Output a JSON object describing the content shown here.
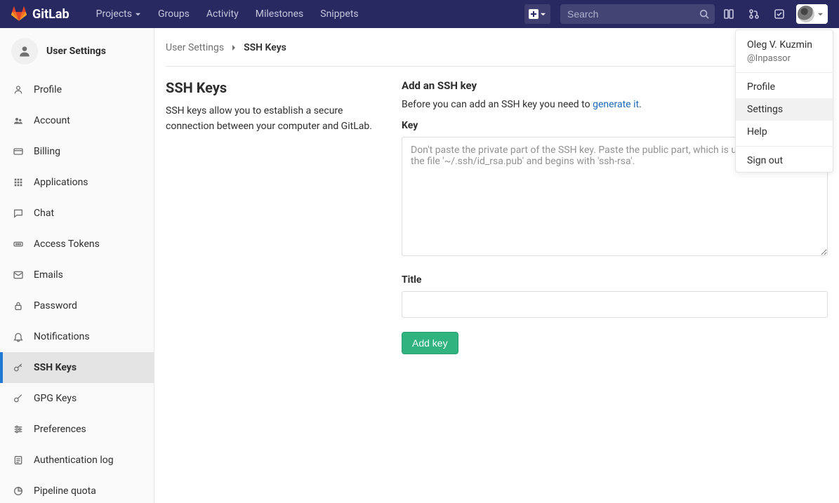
{
  "navbar": {
    "brand": "GitLab",
    "links": {
      "projects": "Projects",
      "groups": "Groups",
      "activity": "Activity",
      "milestones": "Milestones",
      "snippets": "Snippets"
    },
    "search_placeholder": "Search"
  },
  "user_menu": {
    "name": "Oleg V. Kuzmin",
    "handle": "@Inpassor",
    "items": {
      "profile": "Profile",
      "settings": "Settings",
      "help": "Help",
      "sign_out": "Sign out"
    }
  },
  "sidebar": {
    "context_title": "User Settings",
    "items": [
      {
        "label": "Profile",
        "icon": "profile-icon"
      },
      {
        "label": "Account",
        "icon": "account-icon"
      },
      {
        "label": "Billing",
        "icon": "billing-icon"
      },
      {
        "label": "Applications",
        "icon": "apps-icon"
      },
      {
        "label": "Chat",
        "icon": "chat-icon"
      },
      {
        "label": "Access Tokens",
        "icon": "tokens-icon"
      },
      {
        "label": "Emails",
        "icon": "emails-icon"
      },
      {
        "label": "Password",
        "icon": "password-icon"
      },
      {
        "label": "Notifications",
        "icon": "notifications-icon"
      },
      {
        "label": "SSH Keys",
        "icon": "ssh-icon",
        "active": true
      },
      {
        "label": "GPG Keys",
        "icon": "gpg-icon"
      },
      {
        "label": "Preferences",
        "icon": "prefs-icon"
      },
      {
        "label": "Authentication log",
        "icon": "authlog-icon"
      },
      {
        "label": "Pipeline quota",
        "icon": "quota-icon"
      }
    ]
  },
  "breadcrumb": {
    "root": "User Settings",
    "current": "SSH Keys"
  },
  "page": {
    "title": "SSH Keys",
    "description": "SSH keys allow you to establish a secure connection between your computer and GitLab.",
    "add_heading": "Add an SSH key",
    "before_text": "Before you can add an SSH key you need to ",
    "generate_link": "generate it",
    "after_text": ".",
    "key_label": "Key",
    "key_placeholder": "Don't paste the private part of the SSH key. Paste the public part, which is usually contained in the file '~/.ssh/id_rsa.pub' and begins with 'ssh-rsa'.",
    "title_label": "Title",
    "add_button": "Add key"
  }
}
